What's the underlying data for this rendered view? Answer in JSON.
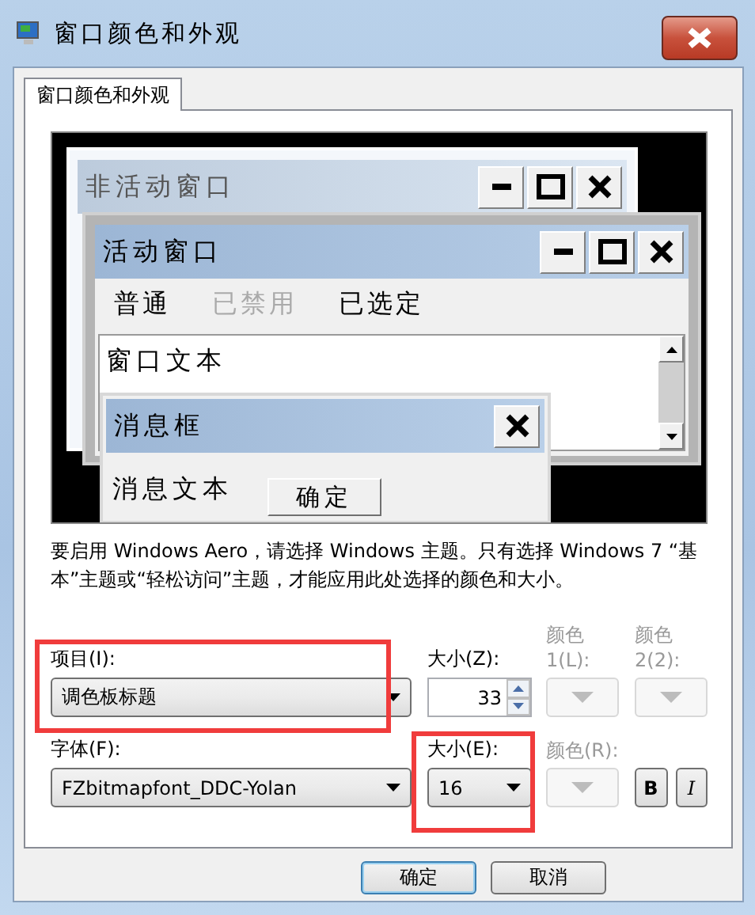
{
  "window": {
    "title": "窗口颜色和外观"
  },
  "tabs": [
    {
      "label": "窗口颜色和外观",
      "selected": true
    }
  ],
  "preview": {
    "inactive_window": {
      "title": "非活动窗口"
    },
    "active_window": {
      "title": "活动窗口",
      "menu": [
        {
          "label": "普通",
          "disabled": false
        },
        {
          "label": "已禁用",
          "disabled": true
        },
        {
          "label": "已选定",
          "disabled": false
        }
      ],
      "window_text": "窗口文本"
    },
    "message_box": {
      "title": "消息框",
      "text": "消息文本",
      "button": "确定"
    }
  },
  "note": "要启用 Windows Aero，请选择 Windows 主题。只有选择 Windows 7 “基本”主题或“轻松访问”主题，才能应用此处选择的颜色和大小。",
  "item": {
    "label": "项目(I):",
    "value": "调色板标题"
  },
  "item_size": {
    "label": "大小(Z):",
    "value": "33"
  },
  "color1": {
    "label": "颜色 1(L):",
    "disabled": true
  },
  "color2": {
    "label": "颜色 2(2):",
    "disabled": true
  },
  "font": {
    "label": "字体(F):",
    "value": "FZbitmapfont_DDC-Yolan"
  },
  "font_size": {
    "label": "大小(E):",
    "value": "16"
  },
  "font_color": {
    "label": "颜色(R):",
    "disabled": true
  },
  "bold": {
    "label": "B"
  },
  "italic": {
    "label": "I"
  },
  "buttons": [
    "确定",
    "取消"
  ]
}
